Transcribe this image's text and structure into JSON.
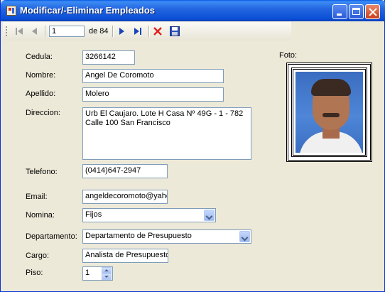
{
  "window": {
    "title": "Modificar/-Eliminar Empleados"
  },
  "navigator": {
    "position": "1",
    "of_label": "de 84"
  },
  "form": {
    "cedula_label": "Cedula:",
    "cedula_value": "3266142",
    "nombre_label": "Nombre:",
    "nombre_value": "Angel De Coromoto",
    "apellido_label": "Apellido:",
    "apellido_value": "Molero",
    "direccion_label": "Direccion:",
    "direccion_value": "Urb El Caujaro. Lote H Casa Nº 49G - 1 - 782\nCalle 100 San Francisco",
    "telefono_label": "Telefono:",
    "telefono_value": "(0414)647-2947",
    "email_label": "Email:",
    "email_value": "angeldecoromoto@yahc",
    "nomina_label": "Nomina:",
    "nomina_value": "Fijos",
    "departamento_label": "Departamento:",
    "departamento_value": "Departamento de Presupuesto",
    "cargo_label": "Cargo:",
    "cargo_value": "Analista de Presupuesto",
    "piso_label": "Piso:",
    "piso_value": "1",
    "foto_label": "Foto:"
  },
  "icons": {
    "move_first": "move-first-icon",
    "move_previous": "move-previous-icon",
    "move_next": "move-next-icon",
    "move_last": "move-last-icon",
    "delete": "delete-icon",
    "save": "save-icon"
  }
}
